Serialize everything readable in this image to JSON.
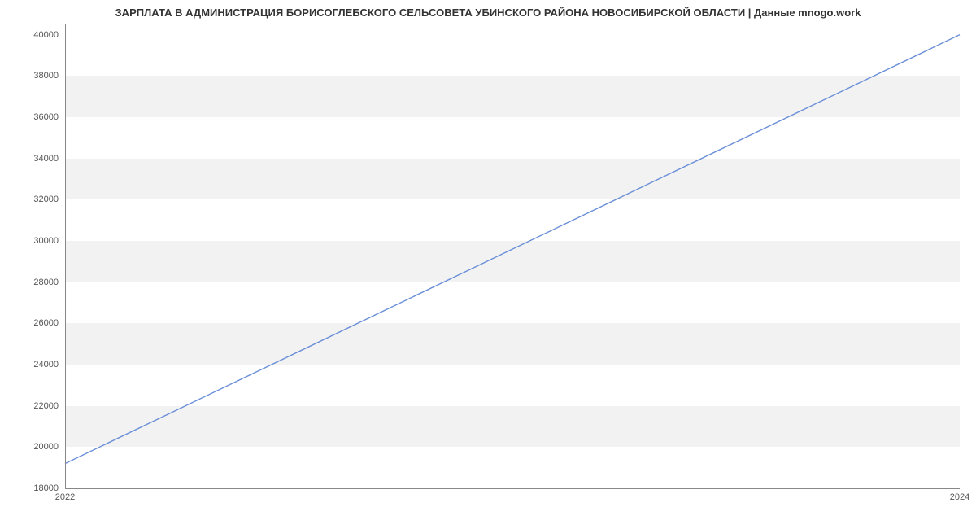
{
  "chart_data": {
    "type": "line",
    "title": "ЗАРПЛАТА В АДМИНИСТРАЦИЯ БОРИСОГЛЕБСКОГО СЕЛЬСОВЕТА УБИНСКОГО РАЙОНА НОВОСИБИРСКОЙ ОБЛАСТИ | Данные mnogo.work",
    "x": [
      2022,
      2024
    ],
    "values": [
      19200,
      40000
    ],
    "xlabel": "",
    "ylabel": "",
    "x_ticks": [
      2022,
      2024
    ],
    "y_ticks": [
      18000,
      20000,
      22000,
      24000,
      26000,
      28000,
      30000,
      32000,
      34000,
      36000,
      38000,
      40000
    ],
    "xlim": [
      2022,
      2024
    ],
    "ylim": [
      18000,
      40500
    ],
    "line_color": "#6a8fd8",
    "grid": "banded"
  }
}
